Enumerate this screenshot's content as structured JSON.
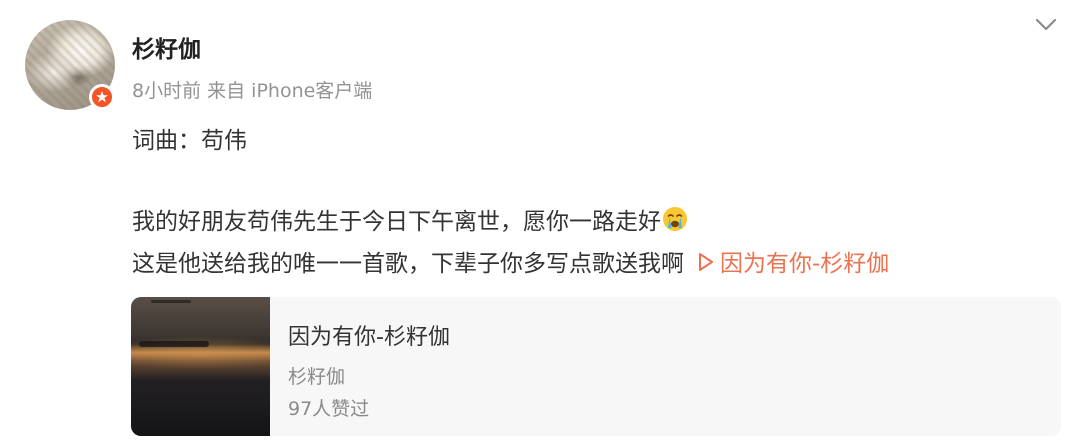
{
  "post": {
    "username": "杉籽伽",
    "meta": "8小时前 来自 iPhone客户端",
    "line1": "词曲：苟伟",
    "line2": "我的好朋友苟伟先生于今日下午离世，愿你一路走好",
    "line3": "这是他送给我的唯一一首歌，下辈子你多写点歌送我啊",
    "music_link": "因为有你-杉籽伽"
  },
  "card": {
    "title": "因为有你-杉籽伽",
    "artist": "杉籽伽",
    "likes": "97人赞过"
  },
  "icons": {
    "badge": "verified-badge-icon",
    "menu": "chevron-down-icon",
    "emoji": "crying-emoji-icon",
    "play": "play-triangle-icon"
  },
  "colors": {
    "link": "#eb7350",
    "badge": "#f35428",
    "meta": "#939393"
  }
}
